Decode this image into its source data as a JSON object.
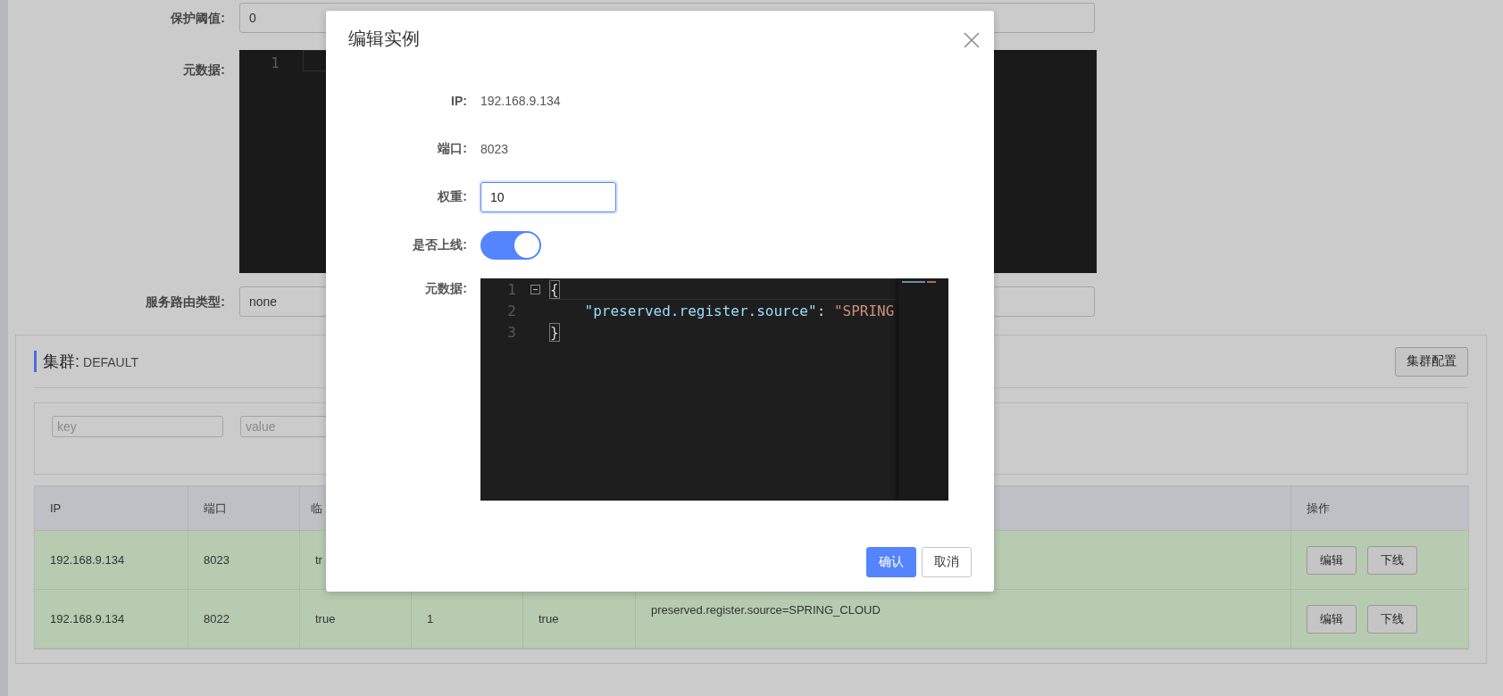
{
  "page": {
    "form": [
      {
        "label": "保护阈值:",
        "kind": "input",
        "value": "0"
      },
      {
        "label": "元数据:",
        "kind": "editor",
        "lines": [
          {
            "number": "1"
          }
        ]
      },
      {
        "label": "服务路由类型:",
        "kind": "input",
        "value": "none"
      }
    ],
    "cluster": {
      "title": "集群:",
      "name": "DEFAULT",
      "config_button": "集群配置",
      "filters": [
        {
          "placeholder": "key"
        },
        {
          "placeholder": "value"
        }
      ],
      "table": {
        "columns": [
          "IP",
          "端口",
          "临",
          "",
          "",
          "",
          "操作"
        ],
        "rows": [
          {
            "cells": [
              "192.168.9.134",
              "8023",
              "tr",
              "",
              "",
              ""
            ],
            "actions": [
              "编辑",
              "下线"
            ]
          },
          {
            "cells": [
              "192.168.9.134",
              "8022",
              "true",
              "1",
              "true",
              "preserved.register.source=SPRING_CLOUD"
            ],
            "actions": [
              "编辑",
              "下线"
            ]
          }
        ]
      }
    }
  },
  "dialog": {
    "title": "编辑实例",
    "fields": [
      {
        "label": "IP:",
        "kind": "text",
        "value": "192.168.9.134"
      },
      {
        "label": "端口:",
        "kind": "text",
        "value": "8023"
      },
      {
        "label": "权重:",
        "kind": "input",
        "value": "10"
      },
      {
        "label": "是否上线:",
        "kind": "switch",
        "on": true
      },
      {
        "label": "元数据:",
        "kind": "editor",
        "lines": [
          {
            "number": "1",
            "fold": true,
            "tokens": [
              {
                "kind": "brace",
                "text": "{"
              }
            ]
          },
          {
            "number": "2",
            "tokens": [
              {
                "kind": "key",
                "text": "    \"preserved.register.source\""
              },
              {
                "kind": "punct",
                "text": ": "
              },
              {
                "kind": "string",
                "text": "\"SPRING"
              }
            ]
          },
          {
            "number": "3",
            "tokens": [
              {
                "kind": "brace",
                "text": "}"
              }
            ]
          }
        ]
      }
    ],
    "buttons": [
      {
        "label": "确认",
        "primary": true
      },
      {
        "label": "取消",
        "primary": false
      }
    ]
  }
}
